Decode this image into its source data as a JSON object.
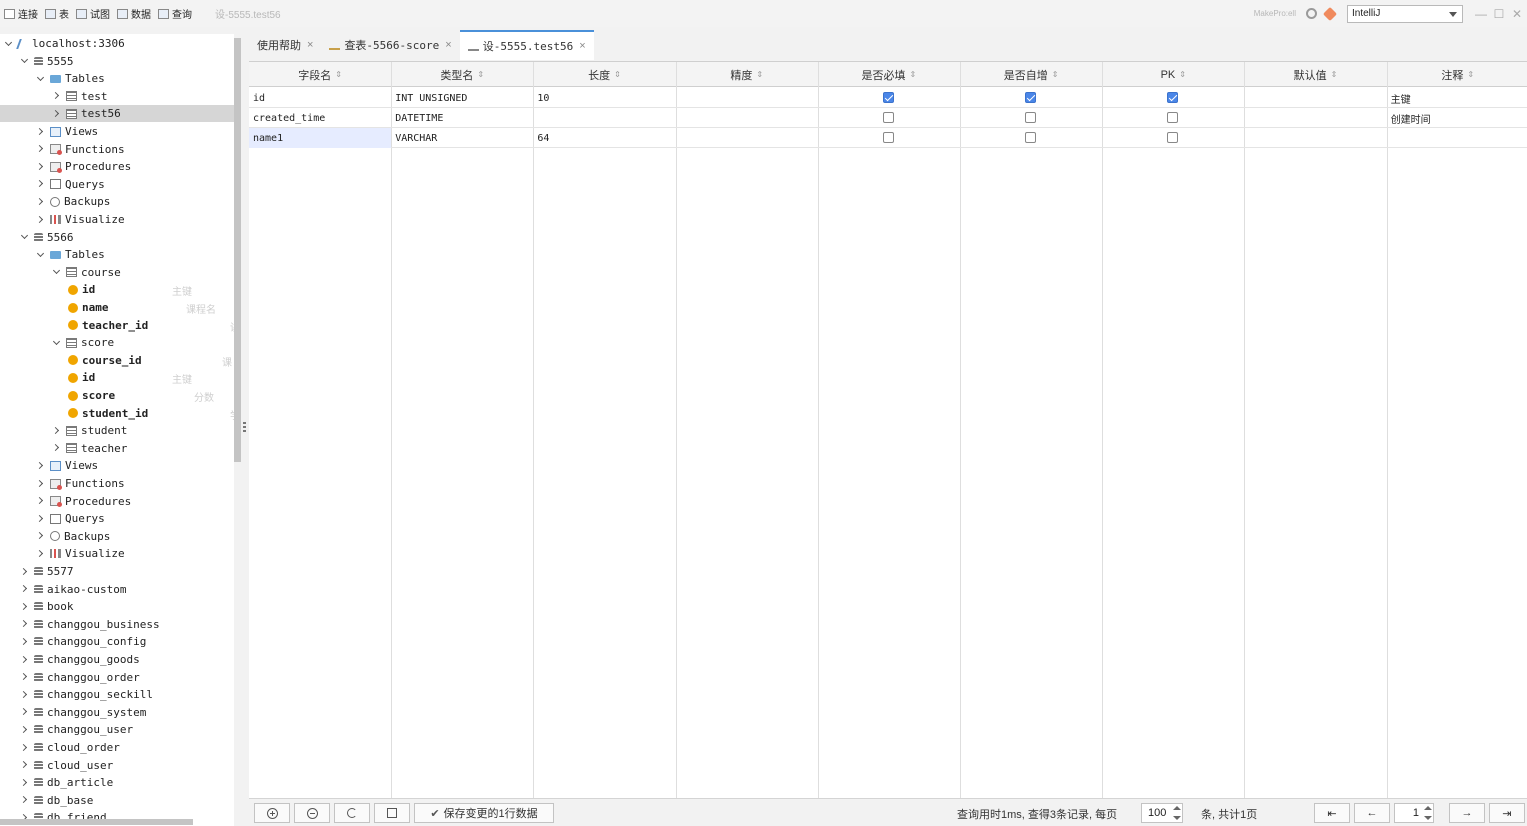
{
  "toolbar": {
    "items": [
      {
        "label": "连接",
        "icon": "connect-icon"
      },
      {
        "label": "表",
        "icon": "table-icon"
      },
      {
        "label": "试图",
        "icon": "view-icon"
      },
      {
        "label": "数据",
        "icon": "data-icon"
      },
      {
        "label": "查询",
        "icon": "query-icon"
      }
    ],
    "context": "设-5555.test56",
    "brand": "MakePro:ell",
    "theme_select": "IntelliJ",
    "window_controls": [
      "—",
      "☐",
      "✕"
    ]
  },
  "tree": {
    "nodes": [
      {
        "label": "localhost:3306",
        "icon": "conn",
        "expanded": true,
        "selected": false
      },
      {
        "label": "5555",
        "icon": "db",
        "expanded": true,
        "selected": false
      },
      {
        "label": "Tables",
        "icon": "folder",
        "expanded": true,
        "selected": false
      },
      {
        "label": "test",
        "icon": "table",
        "expanded": false,
        "selected": false
      },
      {
        "label": "test56",
        "icon": "table",
        "expanded": false,
        "selected": true
      },
      {
        "label": "Views",
        "icon": "view",
        "expanded": false,
        "selected": false
      },
      {
        "label": "Functions",
        "icon": "func",
        "expanded": false,
        "selected": false
      },
      {
        "label": "Procedures",
        "icon": "func",
        "expanded": false,
        "selected": false
      },
      {
        "label": "Querys",
        "icon": "query",
        "expanded": false,
        "selected": false
      },
      {
        "label": "Backups",
        "icon": "backup",
        "expanded": false,
        "selected": false
      },
      {
        "label": "Visualize",
        "icon": "viz",
        "expanded": false,
        "selected": false
      },
      {
        "label": "5566",
        "icon": "db",
        "expanded": true,
        "selected": false
      },
      {
        "label": "Tables",
        "icon": "folder",
        "expanded": true,
        "selected": false
      },
      {
        "label": "course",
        "icon": "table",
        "expanded": true,
        "selected": false
      },
      {
        "label": "id",
        "icon": "field",
        "comment": "主键"
      },
      {
        "label": "name",
        "icon": "field",
        "comment": "课程名"
      },
      {
        "label": "teacher_id",
        "icon": "field",
        "comment": "讲"
      },
      {
        "label": "score",
        "icon": "table",
        "expanded": true,
        "selected": false
      },
      {
        "label": "course_id",
        "icon": "field",
        "comment": "课"
      },
      {
        "label": "id",
        "icon": "field",
        "comment": "主键"
      },
      {
        "label": "score",
        "icon": "field",
        "comment": "分数"
      },
      {
        "label": "student_id",
        "icon": "field",
        "comment": "学"
      },
      {
        "label": "student",
        "icon": "table",
        "expanded": false,
        "selected": false
      },
      {
        "label": "teacher",
        "icon": "table",
        "expanded": false,
        "selected": false
      },
      {
        "label": "Views",
        "icon": "view",
        "expanded": false,
        "selected": false
      },
      {
        "label": "Functions",
        "icon": "func",
        "expanded": false,
        "selected": false
      },
      {
        "label": "Procedures",
        "icon": "func",
        "expanded": false,
        "selected": false
      },
      {
        "label": "Querys",
        "icon": "query",
        "expanded": false,
        "selected": false
      },
      {
        "label": "Backups",
        "icon": "backup",
        "expanded": false,
        "selected": false
      },
      {
        "label": "Visualize",
        "icon": "viz",
        "expanded": false,
        "selected": false
      },
      {
        "label": "5577",
        "icon": "db",
        "expanded": false,
        "selected": false
      },
      {
        "label": "aikao-custom",
        "icon": "db",
        "expanded": false,
        "selected": false
      },
      {
        "label": "book",
        "icon": "db",
        "expanded": false,
        "selected": false
      },
      {
        "label": "changgou_business",
        "icon": "db",
        "expanded": false,
        "selected": false
      },
      {
        "label": "changgou_config",
        "icon": "db",
        "expanded": false,
        "selected": false
      },
      {
        "label": "changgou_goods",
        "icon": "db",
        "expanded": false,
        "selected": false
      },
      {
        "label": "changgou_order",
        "icon": "db",
        "expanded": false,
        "selected": false
      },
      {
        "label": "changgou_seckill",
        "icon": "db",
        "expanded": false,
        "selected": false
      },
      {
        "label": "changgou_system",
        "icon": "db",
        "expanded": false,
        "selected": false
      },
      {
        "label": "changgou_user",
        "icon": "db",
        "expanded": false,
        "selected": false
      },
      {
        "label": "cloud_order",
        "icon": "db",
        "expanded": false,
        "selected": false
      },
      {
        "label": "cloud_user",
        "icon": "db",
        "expanded": false,
        "selected": false
      },
      {
        "label": "db_article",
        "icon": "db",
        "expanded": false,
        "selected": false
      },
      {
        "label": "db_base",
        "icon": "db",
        "expanded": false,
        "selected": false
      },
      {
        "label": "db_friend",
        "icon": "db",
        "expanded": false,
        "selected": false
      }
    ]
  },
  "tabs": [
    {
      "label": "使用帮助",
      "icon": "",
      "active": false
    },
    {
      "label": "查表-5566-score",
      "icon": "query-icon",
      "active": false
    },
    {
      "label": "设-5555.test56",
      "icon": "pencil-icon",
      "active": true
    }
  ],
  "grid": {
    "columns": [
      "字段名",
      "类型名",
      "长度",
      "精度",
      "是否必填",
      "是否自增",
      "PK",
      "默认值",
      "注释"
    ],
    "rows": [
      {
        "name": "id",
        "type": "INT UNSIGNED",
        "length": "10",
        "precision": "",
        "required": true,
        "auto_increment": true,
        "pk": true,
        "default": "",
        "comment": "主键"
      },
      {
        "name": "created_time",
        "type": "DATETIME",
        "length": "",
        "precision": "",
        "required": false,
        "auto_increment": false,
        "pk": false,
        "default": "",
        "comment": "创建时间"
      },
      {
        "name": "name1",
        "type": "VARCHAR",
        "length": "64",
        "precision": "",
        "required": false,
        "auto_increment": false,
        "pk": false,
        "default": "",
        "comment": ""
      }
    ]
  },
  "bottom": {
    "save_label": "保存变更的1行数据",
    "status_text": "查询用时1ms, 查得3条记录, 每页",
    "page_size": "100",
    "status_suffix": "条, 共计1页",
    "page_number": "1"
  },
  "colors": {
    "accent": "#4a86e8",
    "selection": "#d6d6d6"
  }
}
